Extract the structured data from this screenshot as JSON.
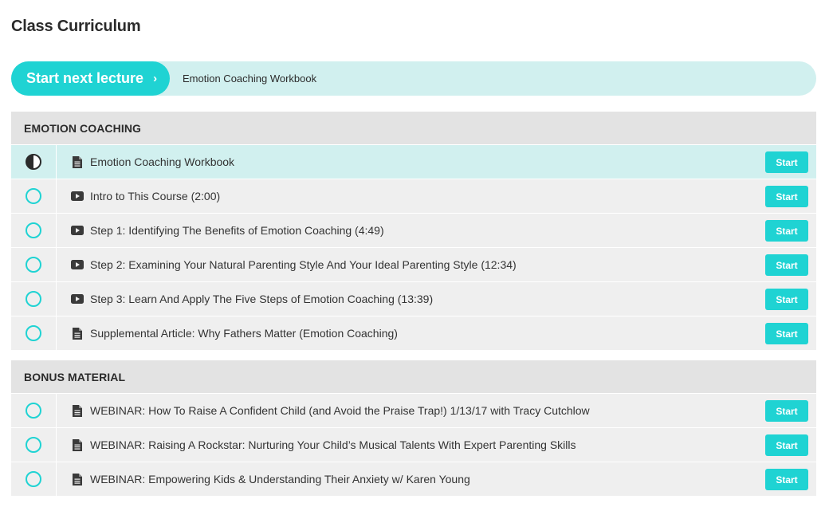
{
  "page": {
    "title": "Class Curriculum"
  },
  "next_lecture": {
    "button_label": "Start next lecture",
    "chevron": "›",
    "lecture_title": "Emotion Coaching Workbook"
  },
  "colors": {
    "accent": "#1fd3d3",
    "accent_light": "#d1f0ef",
    "row_bg": "#efefef",
    "header_bg": "#e3e3e3"
  },
  "sections": [
    {
      "title": "EMOTION COACHING",
      "items": [
        {
          "status": "in-progress",
          "type": "document",
          "icon": "document-icon",
          "title": "Emotion Coaching Workbook",
          "action": "Start"
        },
        {
          "status": "not-started",
          "type": "video",
          "icon": "video-icon",
          "title": "Intro to This Course (2:00)",
          "action": "Start"
        },
        {
          "status": "not-started",
          "type": "video",
          "icon": "video-icon",
          "title": "Step 1: Identifying The Benefits of Emotion Coaching (4:49)",
          "action": "Start"
        },
        {
          "status": "not-started",
          "type": "video",
          "icon": "video-icon",
          "title": "Step 2: Examining Your Natural Parenting Style And Your Ideal Parenting Style (12:34)",
          "action": "Start"
        },
        {
          "status": "not-started",
          "type": "video",
          "icon": "video-icon",
          "title": "Step 3: Learn And Apply The Five Steps of Emotion Coaching (13:39)",
          "action": "Start"
        },
        {
          "status": "not-started",
          "type": "document",
          "icon": "document-icon",
          "title": "Supplemental Article: Why Fathers Matter (Emotion Coaching)",
          "action": "Start"
        }
      ]
    },
    {
      "title": "BONUS MATERIAL",
      "items": [
        {
          "status": "not-started",
          "type": "document",
          "icon": "document-icon",
          "title": "WEBINAR: How To Raise A Confident Child (and Avoid the Praise Trap!) 1/13/17 with Tracy Cutchlow",
          "action": "Start"
        },
        {
          "status": "not-started",
          "type": "document",
          "icon": "document-icon",
          "title": "WEBINAR: Raising A Rockstar: Nurturing Your Child’s Musical Talents With Expert Parenting Skills",
          "action": "Start"
        },
        {
          "status": "not-started",
          "type": "document",
          "icon": "document-icon",
          "title": "WEBINAR: Empowering Kids & Understanding Their Anxiety w/ Karen Young",
          "action": "Start"
        }
      ]
    }
  ]
}
